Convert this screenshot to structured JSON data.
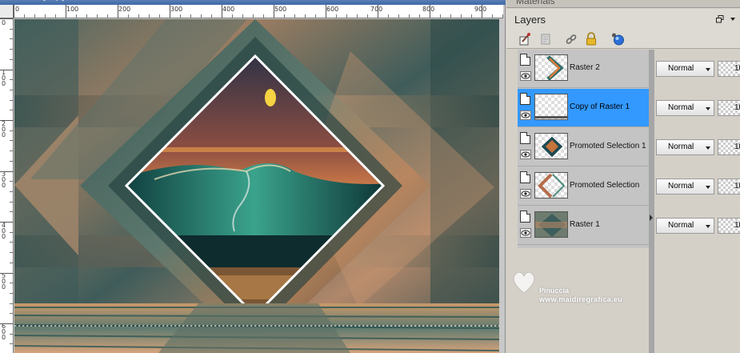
{
  "window": {
    "title_fragment": "— ↓ —/ ↓"
  },
  "rulers": {
    "horizontal_labels": [
      "0",
      "100",
      "200",
      "300",
      "400",
      "500",
      "600",
      "700",
      "800",
      "900"
    ],
    "vertical_labels": [
      "0",
      "100",
      "200",
      "300",
      "400",
      "500",
      "600"
    ]
  },
  "panel": {
    "materials_label": "Materials",
    "layers_title": "Layers",
    "toolbar_icons": [
      "new-layer-icon",
      "layer-properties-icon",
      "link-icon",
      "lock-icon",
      "mask-icon"
    ]
  },
  "layers": [
    {
      "name": "Raster 2",
      "selected": false,
      "blend_mode": "Normal",
      "opacity": "10"
    },
    {
      "name": "Copy of Raster 1",
      "selected": true,
      "blend_mode": "Normal",
      "opacity": "10"
    },
    {
      "name": "Promoted Selection 1",
      "selected": false,
      "blend_mode": "Normal",
      "opacity": "10"
    },
    {
      "name": "Promoted Selection",
      "selected": false,
      "blend_mode": "Normal",
      "opacity": "10"
    },
    {
      "name": "Raster 1",
      "selected": false,
      "blend_mode": "Normal",
      "opacity": "10"
    }
  ],
  "watermark": {
    "name": "Pinuccia",
    "url": "www.maidiregrafica.eu"
  },
  "colors": {
    "selected_layer": "#3399ff",
    "layer_row": "#c4c4c4",
    "panel_bg": "#d4d0c8"
  }
}
